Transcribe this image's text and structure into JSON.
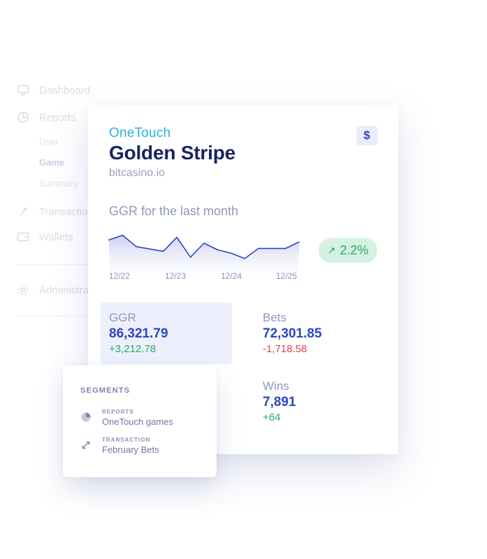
{
  "sidebar": {
    "items": [
      {
        "label": "Dashboard",
        "icon": "monitor-icon"
      },
      {
        "label": "Reports",
        "icon": "pie-chart-icon"
      },
      {
        "label": "Transactions",
        "icon": "transfer-icon"
      },
      {
        "label": "Wallets",
        "icon": "wallet-icon"
      },
      {
        "label": "Administration",
        "icon": "gear-icon"
      }
    ],
    "report_subitems": [
      {
        "label": "User"
      },
      {
        "label": "Game",
        "active": true
      },
      {
        "label": "Summary"
      }
    ]
  },
  "game_card": {
    "provider": "OneTouch",
    "title": "Golden Stripe",
    "site": "bitcasino.io",
    "currency_icon": "dollar-icon",
    "currency_symbol": "$"
  },
  "ggr_chart": {
    "title": "GGR for the last month",
    "trend": "2.2%",
    "trend_direction": "up",
    "colors": {
      "line": "#2b46c2",
      "fill_top": "#c7cdf2",
      "trend_bg": "#d4f1e2",
      "trend_text": "#27a968"
    }
  },
  "chart_data": {
    "type": "area",
    "title": "GGR for the last month",
    "x_tick_labels": [
      "12/22",
      "12/23",
      "12/24",
      "12/25"
    ],
    "values": [
      0.7,
      0.88,
      0.45,
      0.36,
      0.27,
      0.8,
      0.05,
      0.58,
      0.33,
      0.2,
      0.0,
      0.38,
      0.38,
      0.38,
      0.62
    ],
    "y_axis_shown": false,
    "grid": false
  },
  "stats": [
    {
      "label": "GGR",
      "value": "86,321.79",
      "delta": "+3,212.78",
      "delta_sign": "positive",
      "selected": true
    },
    {
      "label": "Bets",
      "value": "72,301.85",
      "delta": "-1,718.58",
      "delta_sign": "negative",
      "selected": false
    },
    {
      "label": "Wins",
      "value": "7,891",
      "delta": "+64",
      "delta_sign": "positive",
      "selected": false
    }
  ],
  "segments": {
    "title": "SEGMENTS",
    "items": [
      {
        "category": "REPORTS",
        "name": "OneTouch games",
        "icon": "pie-chart-icon"
      },
      {
        "category": "TRANSACTION",
        "name": "February Bets",
        "icon": "transfer-icon"
      }
    ]
  }
}
